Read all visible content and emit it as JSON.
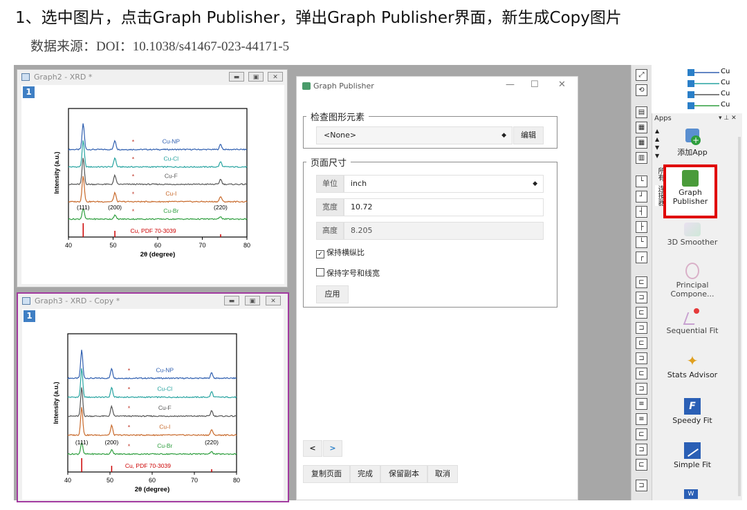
{
  "heading": "1、选中图片，点击Graph Publisher，弹出Graph Publisher界面，新生成Copy图片",
  "subheading": "数据来源：DOI：10.1038/s41467-023-44171-5",
  "windows": [
    {
      "title": "Graph2 - XRD *",
      "layer": "1"
    },
    {
      "title": "Graph3 - XRD - Copy *",
      "layer": "1"
    }
  ],
  "chart_data": {
    "type": "line",
    "xlabel": "2θ (degree)",
    "ylabel": "Intensity (a.u.)",
    "xlim": [
      40,
      80
    ],
    "xticks": [
      "40",
      "50",
      "60",
      "70",
      "80"
    ],
    "series": [
      {
        "name": "Cu-NP",
        "color": "#2f5fb0",
        "offset": 5,
        "peaks": [
          [
            43.3,
            1.0
          ],
          [
            50.4,
            0.35
          ],
          [
            74.1,
            0.2
          ]
        ],
        "star": 54.5
      },
      {
        "name": "Cu-Cl",
        "color": "#26a3a0",
        "offset": 4,
        "peaks": [
          [
            43.3,
            1.0
          ],
          [
            50.4,
            0.35
          ],
          [
            74.1,
            0.2
          ]
        ],
        "star": 54.5
      },
      {
        "name": "Cu-F",
        "color": "#555555",
        "offset": 3,
        "peaks": [
          [
            43.3,
            1.0
          ],
          [
            50.4,
            0.35
          ],
          [
            74.1,
            0.2
          ]
        ],
        "star": 54.5
      },
      {
        "name": "Cu-I",
        "color": "#c8692a",
        "offset": 2,
        "peaks": [
          [
            43.3,
            1.0
          ],
          [
            50.4,
            0.35
          ],
          [
            74.1,
            0.2
          ]
        ],
        "star": 54.5
      },
      {
        "name": "Cu-Br",
        "color": "#2e9e3e",
        "offset": 1,
        "peaks": [
          [
            43.3,
            0.4
          ],
          [
            50.4,
            0.15
          ],
          [
            74.1,
            0.1
          ]
        ],
        "star": 54.5
      }
    ],
    "reference": {
      "name": "Cu, PDF 70-3039",
      "color": "#cc0000",
      "lines": [
        [
          43.3,
          1.0
        ],
        [
          50.4,
          0.45
        ],
        [
          74.1,
          0.2
        ]
      ]
    },
    "annotations": [
      "(111)",
      "(200)",
      "(220)"
    ],
    "star_symbol": "*"
  },
  "publisher": {
    "title": "Graph Publisher",
    "inspect_legend": "检查图形元素",
    "element_select": "<None>",
    "edit_button": "编辑",
    "page_legend": "页面尺寸",
    "unit_label": "单位",
    "unit_value": "inch",
    "width_label": "宽度",
    "width_value": "10.72",
    "height_label": "高度",
    "height_value": "8.205",
    "keep_aspect": "保持横纵比",
    "keep_font": "保持字号和线宽",
    "apply_button": "应用",
    "prev": "<",
    "next": ">",
    "buttons": [
      "复制页面",
      "完成",
      "保留副本",
      "取消"
    ]
  },
  "legend_items": [
    "Cu",
    "Cu",
    "Cu",
    "Cu"
  ],
  "apps_panel": {
    "title": "Apps",
    "tab1": "所有",
    "tab2": "连接器",
    "apps": [
      "添加App",
      "Graph Publisher",
      "3D Smoother",
      "Principal Compone...",
      "Sequential Fit",
      "Stats Advisor",
      "Speedy Fit",
      "Simple Fit"
    ]
  },
  "colors": {
    "highlight": "#e00000",
    "accent": "#3f7fc4",
    "copy_border": "#a23ba0"
  }
}
